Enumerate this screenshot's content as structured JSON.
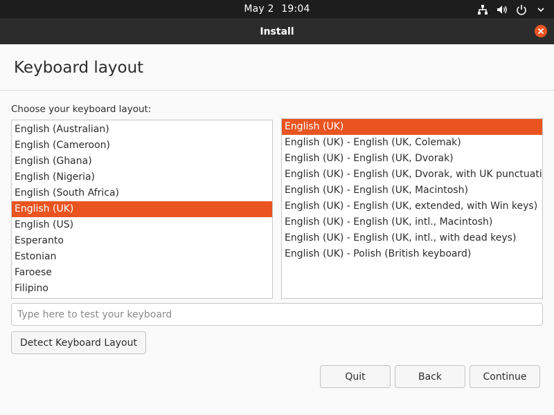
{
  "topbar": {
    "date": "May 2",
    "time": "19:04",
    "icons": [
      "network-icon",
      "volume-icon",
      "power-icon",
      "chevron-down-icon"
    ]
  },
  "window": {
    "title": "Install",
    "close_icon": "close-icon"
  },
  "page": {
    "heading": "Keyboard layout",
    "choose_label": "Choose your keyboard layout:"
  },
  "layouts": {
    "items": [
      "English (Australian)",
      "English (Cameroon)",
      "English (Ghana)",
      "English (Nigeria)",
      "English (South Africa)",
      "English (UK)",
      "English (US)",
      "Esperanto",
      "Estonian",
      "Faroese",
      "Filipino"
    ],
    "selected": "English (UK)"
  },
  "variants": {
    "items": [
      "English (UK)",
      "English (UK) - English (UK, Colemak)",
      "English (UK) - English (UK, Dvorak)",
      "English (UK) - English (UK, Dvorak, with UK punctuation)",
      "English (UK) - English (UK, Macintosh)",
      "English (UK) - English (UK, extended, with Win keys)",
      "English (UK) - English (UK, intl., Macintosh)",
      "English (UK) - English (UK, intl., with dead keys)",
      "English (UK) - Polish (British keyboard)"
    ],
    "selected": "English (UK)"
  },
  "test_input": {
    "placeholder": "Type here to test your keyboard",
    "value": ""
  },
  "buttons": {
    "detect": "Detect Keyboard Layout",
    "quit": "Quit",
    "back": "Back",
    "continue": "Continue"
  },
  "colors": {
    "accent": "#e95420",
    "topbar_bg": "#1d1d1d",
    "titlebar_bg": "#2c2c2c",
    "window_bg": "#fafafa"
  }
}
